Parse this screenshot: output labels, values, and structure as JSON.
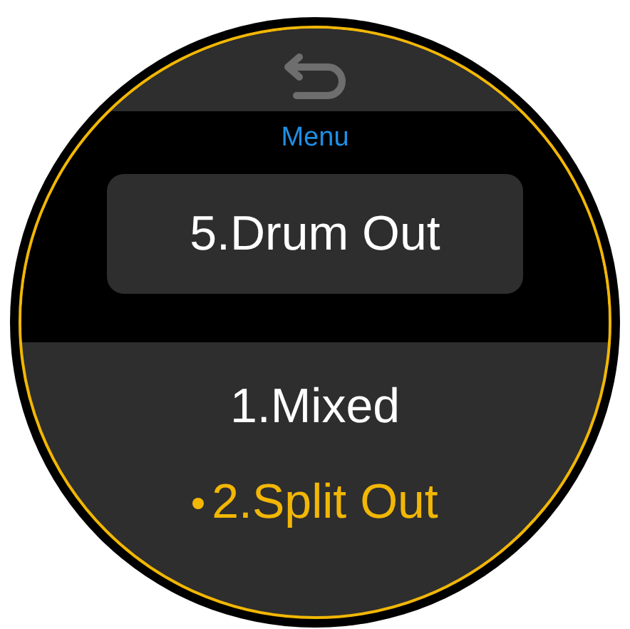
{
  "title": "Menu",
  "current_value": "5.Drum Out",
  "options": [
    {
      "label": "1.Mixed",
      "selected": false
    },
    {
      "label": "2.Split Out",
      "selected": true
    }
  ]
}
